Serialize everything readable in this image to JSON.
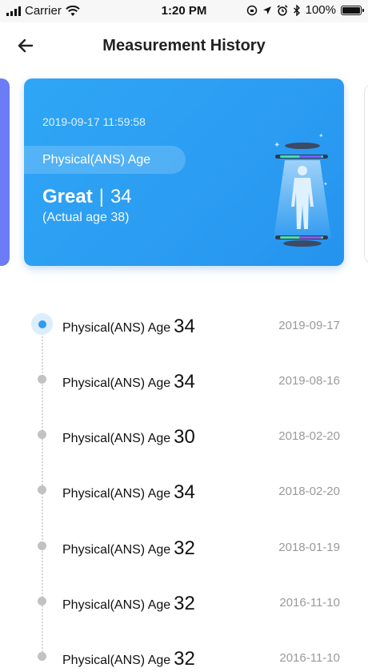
{
  "status_bar": {
    "carrier": "Carrier",
    "time": "1:20 PM",
    "battery": "100%",
    "battery_level": 1.0
  },
  "nav": {
    "title": "Measurement History",
    "back_icon": "arrow-left-icon"
  },
  "card": {
    "date": "2019-09-17 11:59:58",
    "label": "Physical(ANS) Age",
    "rating": "Great",
    "value": "34",
    "actual": "(Actual age 38)",
    "background": "#2b9cf2"
  },
  "history": [
    {
      "label": "Physical(ANS) Age",
      "value": "34",
      "date": "2019-09-17",
      "active": true
    },
    {
      "label": "Physical(ANS) Age",
      "value": "34",
      "date": "2019-08-16",
      "active": false
    },
    {
      "label": "Physical(ANS) Age",
      "value": "30",
      "date": "2018-02-20",
      "active": false
    },
    {
      "label": "Physical(ANS) Age",
      "value": "34",
      "date": "2018-02-20",
      "active": false
    },
    {
      "label": "Physical(ANS) Age",
      "value": "32",
      "date": "2018-01-19",
      "active": false
    },
    {
      "label": "Physical(ANS) Age",
      "value": "32",
      "date": "2016-11-10",
      "active": false
    },
    {
      "label": "Physical(ANS) Age",
      "value": "32",
      "date": "2016-11-10",
      "active": false
    }
  ],
  "colors": {
    "accent": "#2d9cf2",
    "inactive_dot": "#c2c2c2",
    "date_text": "#9a9a9a"
  }
}
